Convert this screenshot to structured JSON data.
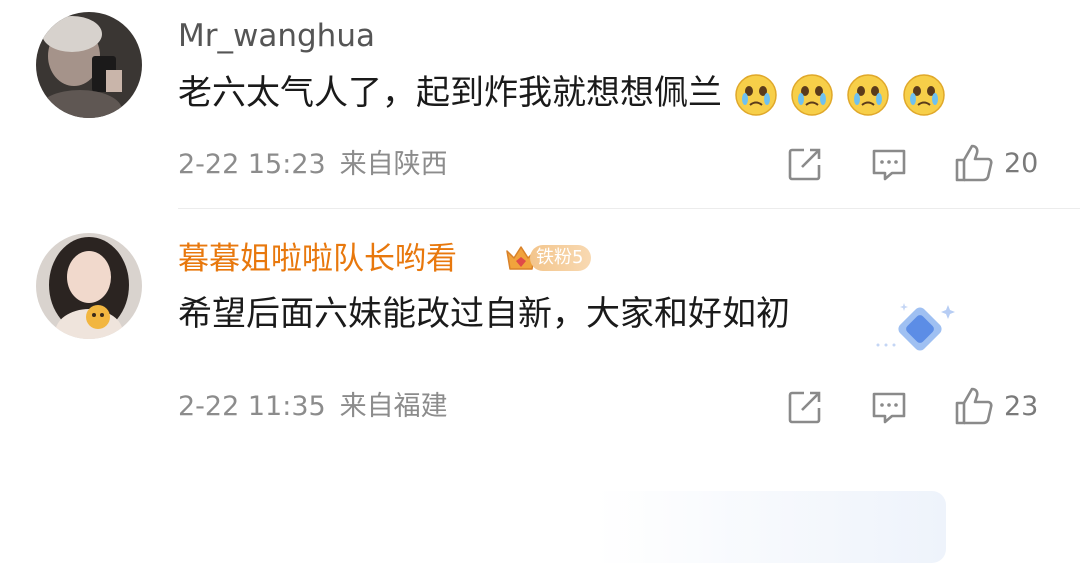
{
  "comments": [
    {
      "username": "Mr_wanghua",
      "text": "老六太气人了，起到炸我就想想佩兰",
      "emojis": [
        "crying-face-emoji",
        "crying-face-emoji",
        "crying-face-emoji",
        "crying-face-emoji"
      ],
      "date": "2-22 15:23",
      "location": "来自陕西",
      "like_count": "20"
    },
    {
      "username": "暮暮姐啦啦队长哟看",
      "fan_badge": "铁粉5",
      "text": "希望后面六妹能改过自新，大家和好如初",
      "date": "2-22 11:35",
      "location": "来自福建",
      "like_count": "23"
    }
  ],
  "colors": {
    "username_default": "#555555",
    "username_vip": "#e8780d",
    "meta": "#8c8c8c",
    "text": "#1a1a1a",
    "icon": "#8a8a8a"
  },
  "icons": [
    "share-icon",
    "comment-icon",
    "like-icon",
    "crown-icon",
    "diamond-decoration-icon"
  ]
}
